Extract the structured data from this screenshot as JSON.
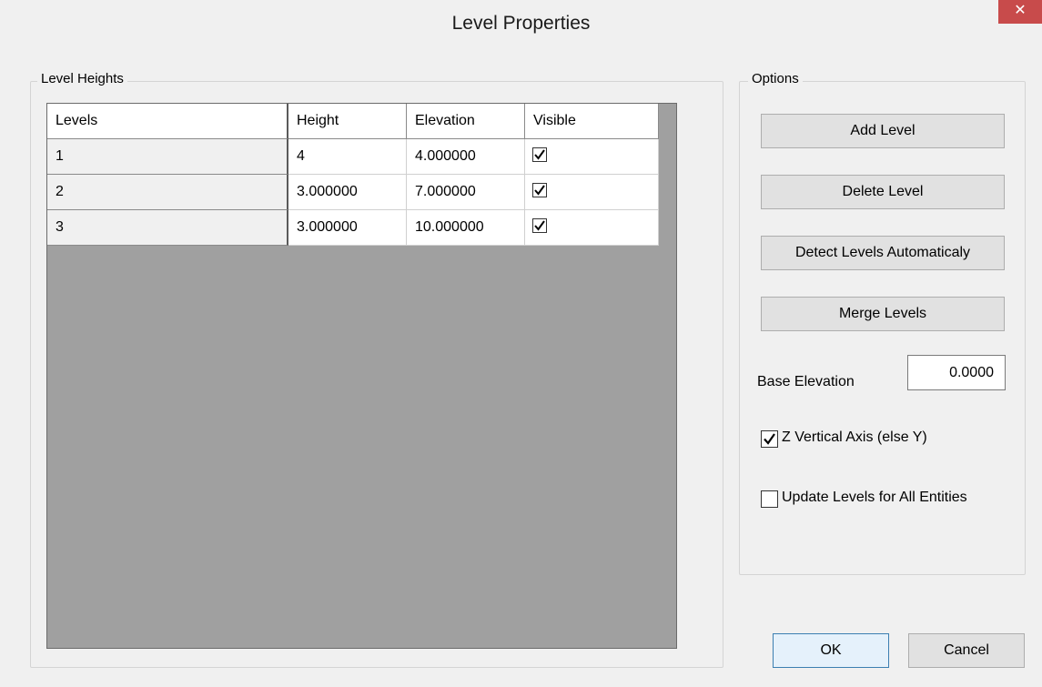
{
  "window": {
    "title": "Level Properties",
    "close_glyph": "✕"
  },
  "level_heights": {
    "label": "Level Heights",
    "columns": [
      "Levels",
      "Height",
      "Elevation",
      "Visible"
    ],
    "rows": [
      {
        "level": "1",
        "height": "4",
        "elevation": "4.000000",
        "visible": true
      },
      {
        "level": "2",
        "height": "3.000000",
        "elevation": "7.000000",
        "visible": true
      },
      {
        "level": "3",
        "height": "3.000000",
        "elevation": "10.000000",
        "visible": true
      }
    ]
  },
  "options": {
    "label": "Options",
    "add_level": "Add Level",
    "delete_level": "Delete Level",
    "detect_levels": "Detect Levels Automaticaly",
    "merge_levels": "Merge Levels",
    "base_elevation_label": "Base Elevation",
    "base_elevation_value": "0.0000",
    "z_vertical_label": "Z Vertical Axis (else Y)",
    "z_vertical_checked": true,
    "update_levels_label": "Update Levels for All Entities",
    "update_levels_checked": false
  },
  "footer": {
    "ok": "OK",
    "cancel": "Cancel"
  },
  "colors": {
    "close_button": "#c84b4b",
    "grid_background": "#a0a0a0",
    "dialog_background": "#f0f0f0"
  }
}
